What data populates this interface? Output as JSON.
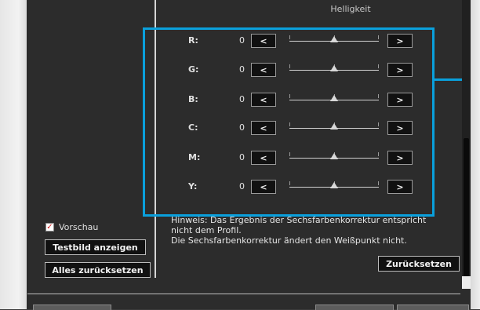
{
  "section": {
    "title": "Helligkeit"
  },
  "rows": [
    {
      "label": "R:",
      "value": "0",
      "level": 0.5
    },
    {
      "label": "G:",
      "value": "0",
      "level": 0.5
    },
    {
      "label": "B:",
      "value": "0",
      "level": 0.5
    },
    {
      "label": "C:",
      "value": "0",
      "level": 0.5
    },
    {
      "label": "M:",
      "value": "0",
      "level": 0.5
    },
    {
      "label": "Y:",
      "value": "0",
      "level": 0.5
    }
  ],
  "buttons": {
    "decrease": "<",
    "increase": ">"
  },
  "preview": {
    "label": "Vorschau",
    "checked": true,
    "mark": "✓"
  },
  "left_buttons": {
    "test_image": "Testbild anzeigen",
    "reset_all": "Alles zurücksetzen"
  },
  "note": {
    "line1": "Hinweis: Das Ergebnis der Sechsfarbenkorrektur entspricht",
    "line2": "nicht dem Profil.",
    "line3": "Die Sechsfarbenkorrektur ändert den Weißpunkt nicht."
  },
  "reset_button": "Zurücksetzen",
  "colors": {
    "highlight": "#0aa0dc",
    "panel": "#2c2c2c",
    "checkmark": "#d02020"
  }
}
